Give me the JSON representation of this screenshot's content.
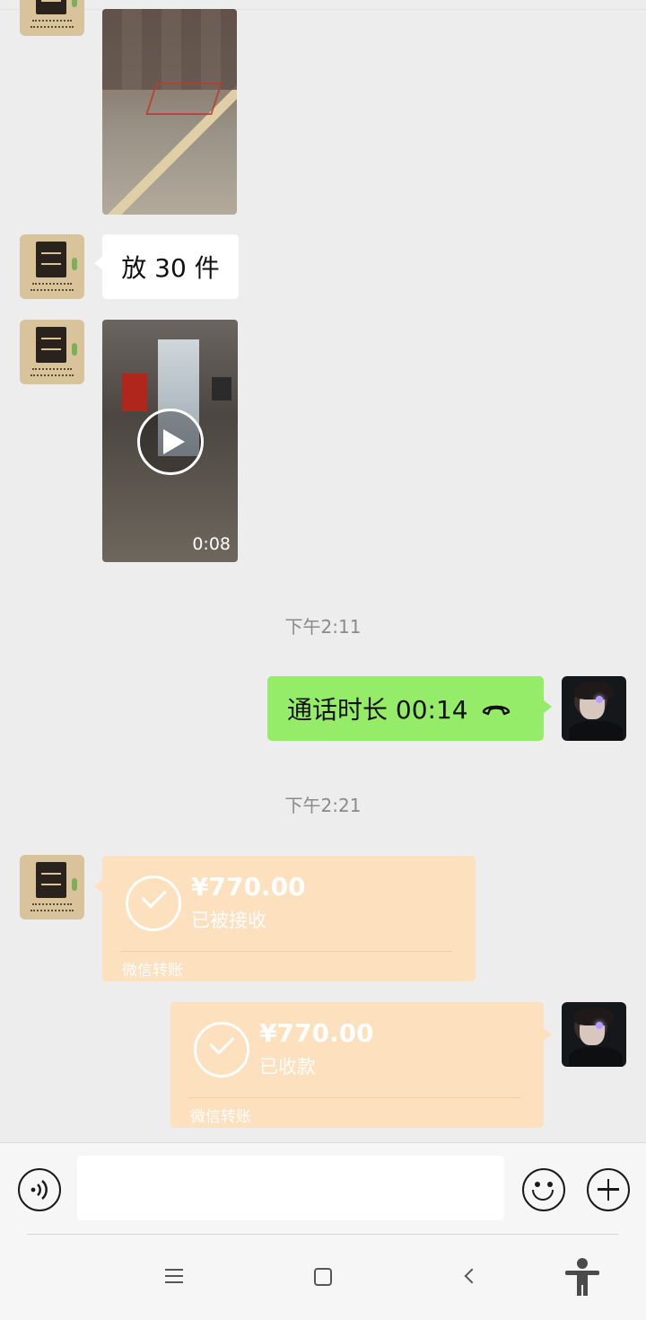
{
  "messages": {
    "text1": "放 30 件",
    "video_duration": "0:08",
    "time1": "下午2:11",
    "call_text": "通话时长 00:14",
    "time2": "下午2:21"
  },
  "transfers": [
    {
      "amount": "¥770.00",
      "status": "已被接收",
      "label": "微信转账"
    },
    {
      "amount": "¥770.00",
      "status": "已收款",
      "label": "微信转账"
    }
  ],
  "colors": {
    "background": "#ededed",
    "outgoing_bubble": "#95ec69",
    "incoming_bubble": "#ffffff",
    "transfer_bubble": "#fde0bd"
  },
  "icons": {
    "voice": "voice-icon",
    "emoji": "emoji-icon",
    "plus": "plus-icon",
    "phone": "phone-hangup-icon",
    "play": "play-icon"
  }
}
